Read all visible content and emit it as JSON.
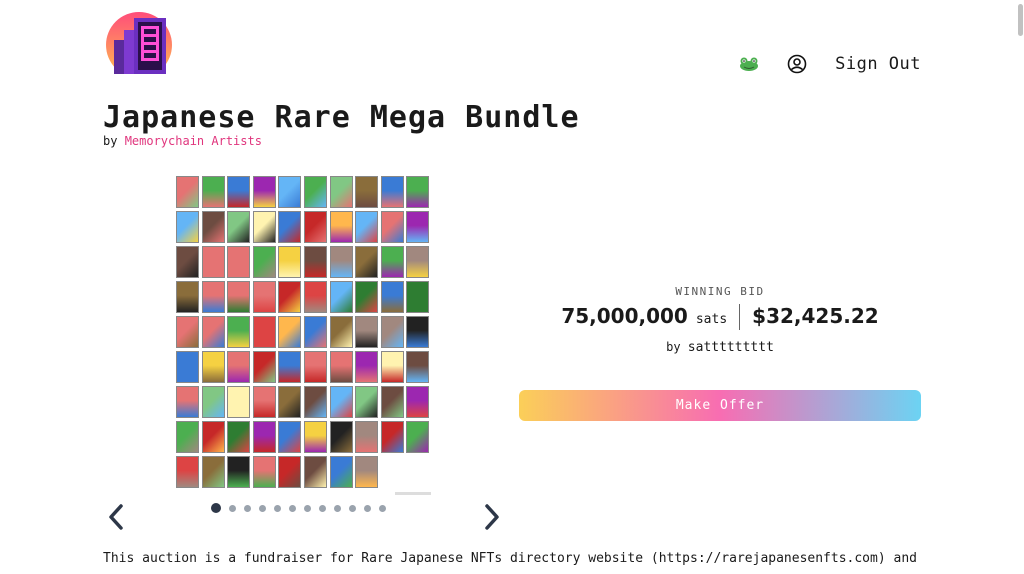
{
  "header": {
    "logo_alt": "Memorychain logo",
    "sign_out_label": "Sign Out"
  },
  "listing": {
    "title": "Japanese Rare Mega Bundle",
    "by_prefix": "by",
    "artist": "Memorychain Artists"
  },
  "bid": {
    "label": "WINNING BID",
    "sats": "75,000,000",
    "sats_unit": "sats",
    "usd": "$32,425.22",
    "by_prefix": "by",
    "bidder": "sattttttttt"
  },
  "actions": {
    "make_offer_label": "Make Offer"
  },
  "carousel": {
    "slide_count": 12,
    "active_index": 0
  },
  "description": {
    "text": "This auction is a fundraiser for Rare Japanese NFTs directory website (https://rarejapanesenfts.com) and"
  },
  "colors": {
    "artist_link": "#e0357d",
    "offer_gradient": [
      "#fbcf58",
      "#f86db2",
      "#6cd3f3"
    ],
    "thumb_palette": [
      "#8a6d3b",
      "#3a7bd5",
      "#d44",
      "#4caf50",
      "#f5d142",
      "#222",
      "#9c27b0",
      "#e57373",
      "#81c784",
      "#ffb74d",
      "#64b5f6",
      "#a1887f",
      "#fff3b0",
      "#2e7d32",
      "#c62828",
      "#6d4c41"
    ]
  }
}
